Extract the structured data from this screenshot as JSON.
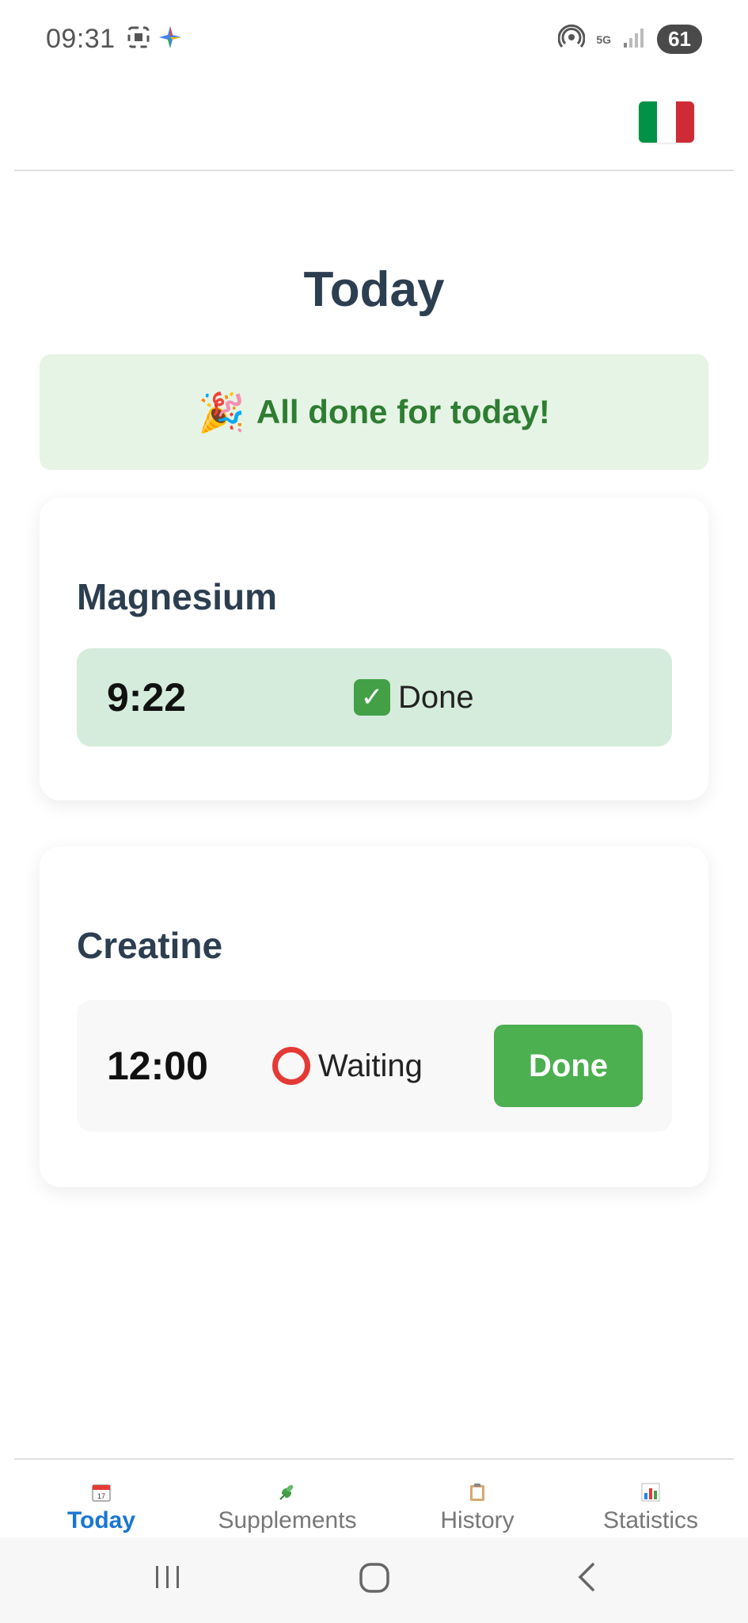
{
  "status_bar": {
    "time": "09:31",
    "network": "5G",
    "battery": "61"
  },
  "header": {
    "language_flag": "italian-flag-icon"
  },
  "page": {
    "title": "Today"
  },
  "banner": {
    "icon": "🎉",
    "text": "All done for today!"
  },
  "supplements": [
    {
      "name": "Magnesium",
      "time": "9:22",
      "status": "Done",
      "status_icon": "check-mark-icon",
      "row_color": "#d5ecdc"
    },
    {
      "name": "Creatine",
      "time": "12:00",
      "status": "Waiting",
      "status_icon": "hollow-circle-icon",
      "row_color": "#f8f8f8",
      "action_label": "Done"
    }
  ],
  "bottom_nav": {
    "items": [
      {
        "label": "Today",
        "icon": "calendar-icon",
        "active": true
      },
      {
        "label": "Supplements",
        "icon": "herb-icon",
        "active": false
      },
      {
        "label": "History",
        "icon": "clipboard-icon",
        "active": false
      },
      {
        "label": "Statistics",
        "icon": "bar-chart-icon",
        "active": false
      }
    ]
  },
  "colors": {
    "accent_green": "#4caf50",
    "banner_bg": "#e6f4e6",
    "banner_text": "#2e7d32",
    "title_text": "#2c3e50",
    "nav_active": "#1976d2"
  }
}
